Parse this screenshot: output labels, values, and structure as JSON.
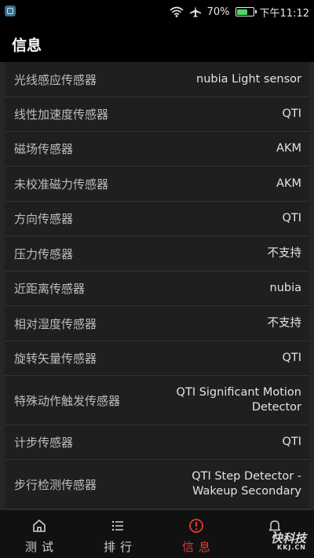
{
  "status_bar": {
    "battery_percent": "70%",
    "time": "下午11:12",
    "battery_level": 0.7,
    "battery_color": "#4cd964"
  },
  "app_bar": {
    "title": "信息"
  },
  "sensors": [
    {
      "label": "光线感应传感器",
      "value": "nubia Light sensor"
    },
    {
      "label": "线性加速度传感器",
      "value": "QTI"
    },
    {
      "label": "磁场传感器",
      "value": "AKM"
    },
    {
      "label": "未校准磁力传感器",
      "value": "AKM"
    },
    {
      "label": "方向传感器",
      "value": "QTI"
    },
    {
      "label": "压力传感器",
      "value": "不支持"
    },
    {
      "label": "近距离传感器",
      "value": "nubia"
    },
    {
      "label": "相对湿度传感器",
      "value": "不支持"
    },
    {
      "label": "旋转矢量传感器",
      "value": "QTI"
    },
    {
      "label": "特殊动作触发传感器",
      "value": "QTI Significant Motion\nDetector"
    },
    {
      "label": "计步传感器",
      "value": "QTI"
    },
    {
      "label": "步行检测传感器",
      "value": "QTI Step Detector -\nWakeup Secondary"
    }
  ],
  "bottom_nav": [
    {
      "label": "测试",
      "icon": "home-icon",
      "active": false
    },
    {
      "label": "排行",
      "icon": "list-icon",
      "active": false
    },
    {
      "label": "信息",
      "icon": "info-icon",
      "active": true
    },
    {
      "label": "",
      "icon": "bell-icon",
      "active": false
    }
  ],
  "watermark": {
    "main": "快科技",
    "sub": "KKJ.CN"
  },
  "colors": {
    "accent": "#e53935"
  }
}
